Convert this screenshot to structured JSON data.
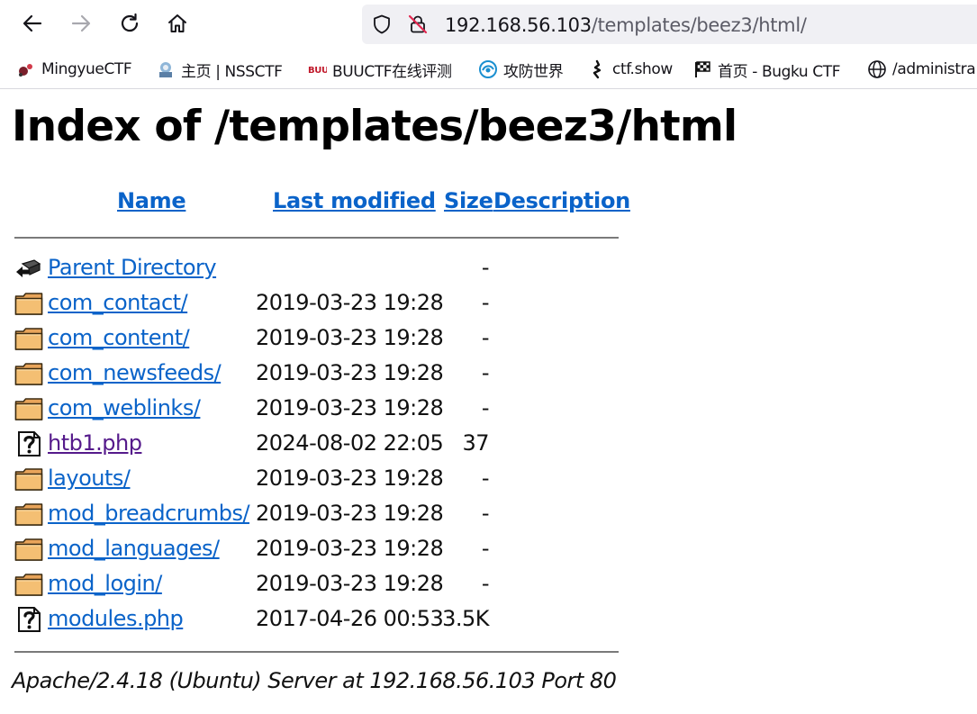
{
  "browser": {
    "url_host": "192.168.56.103",
    "url_path": "/templates/beez3/html/",
    "bookmarks": [
      {
        "label": "MingyueCTF",
        "icon": "mingyue-icon"
      },
      {
        "label": "主页 | NSSCTF",
        "icon": "nssctf-icon"
      },
      {
        "label": "BUUCTF在线评测",
        "icon": "buuctf-icon"
      },
      {
        "label": "攻防世界",
        "icon": "adworld-icon"
      },
      {
        "label": "ctf.show",
        "icon": "ctfshow-icon"
      },
      {
        "label": "首页 - Bugku CTF",
        "icon": "bugku-icon"
      },
      {
        "label": "/administra",
        "icon": "globe-icon"
      }
    ]
  },
  "page": {
    "title": "Index of /templates/beez3/html",
    "columns": {
      "name": "Name",
      "last_modified": "Last modified",
      "size": "Size",
      "description": "Description"
    },
    "entries": [
      {
        "name": "Parent Directory",
        "date": "",
        "size": "-",
        "icon": "parent-directory-icon",
        "visited": false
      },
      {
        "name": "com_contact/",
        "date": "2019-03-23 19:28",
        "size": "-",
        "icon": "folder-icon",
        "visited": false
      },
      {
        "name": "com_content/",
        "date": "2019-03-23 19:28",
        "size": "-",
        "icon": "folder-icon",
        "visited": false
      },
      {
        "name": "com_newsfeeds/",
        "date": "2019-03-23 19:28",
        "size": "-",
        "icon": "folder-icon",
        "visited": false
      },
      {
        "name": "com_weblinks/",
        "date": "2019-03-23 19:28",
        "size": "-",
        "icon": "folder-icon",
        "visited": false
      },
      {
        "name": "htb1.php",
        "date": "2024-08-02 22:05",
        "size": "37",
        "icon": "unknown-file-icon",
        "visited": true
      },
      {
        "name": "layouts/",
        "date": "2019-03-23 19:28",
        "size": "-",
        "icon": "folder-icon",
        "visited": false
      },
      {
        "name": "mod_breadcrumbs/",
        "date": "2019-03-23 19:28",
        "size": "-",
        "icon": "folder-icon",
        "visited": false
      },
      {
        "name": "mod_languages/",
        "date": "2019-03-23 19:28",
        "size": "-",
        "icon": "folder-icon",
        "visited": false
      },
      {
        "name": "mod_login/",
        "date": "2019-03-23 19:28",
        "size": "-",
        "icon": "folder-icon",
        "visited": false
      },
      {
        "name": "modules.php",
        "date": "2017-04-26 00:53",
        "size": "3.5K",
        "icon": "unknown-file-icon",
        "visited": false
      }
    ],
    "footer": "Apache/2.4.18 (Ubuntu) Server at 192.168.56.103 Port 80"
  },
  "colors": {
    "link": "#0a63c9",
    "visited": "#551a8b",
    "urlbar_bg": "#f0f0f4"
  }
}
